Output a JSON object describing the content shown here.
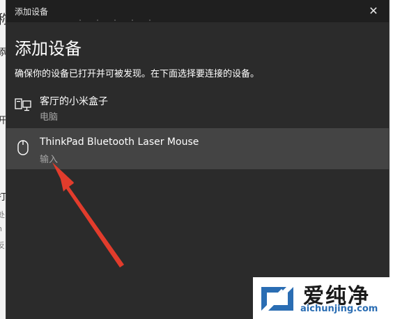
{
  "background": {
    "fragments": [
      "称",
      "添",
      "开",
      "打",
      "处",
      "n",
      "反"
    ]
  },
  "window": {
    "title": "添加设备",
    "close_glyph": "✕"
  },
  "heading": "添加设备",
  "description": "确保你的设备已打开并可被发现。在下面选择要连接的设备。",
  "devices": [
    {
      "name": "客厅的小米盒子",
      "type": "电脑",
      "icon": "computer-icon",
      "selected": false
    },
    {
      "name": "ThinkPad Bluetooth Laser Mouse",
      "type": "输入",
      "icon": "mouse-icon",
      "selected": true
    }
  ],
  "watermark": {
    "text": "爱纯净",
    "url": "aichunjing.com"
  },
  "colors": {
    "dialog_bg": "#2b2b2b",
    "titlebar_bg": "#1f1f1f",
    "selected_bg": "#444444",
    "annotation_arrow": "#e23c2c"
  }
}
